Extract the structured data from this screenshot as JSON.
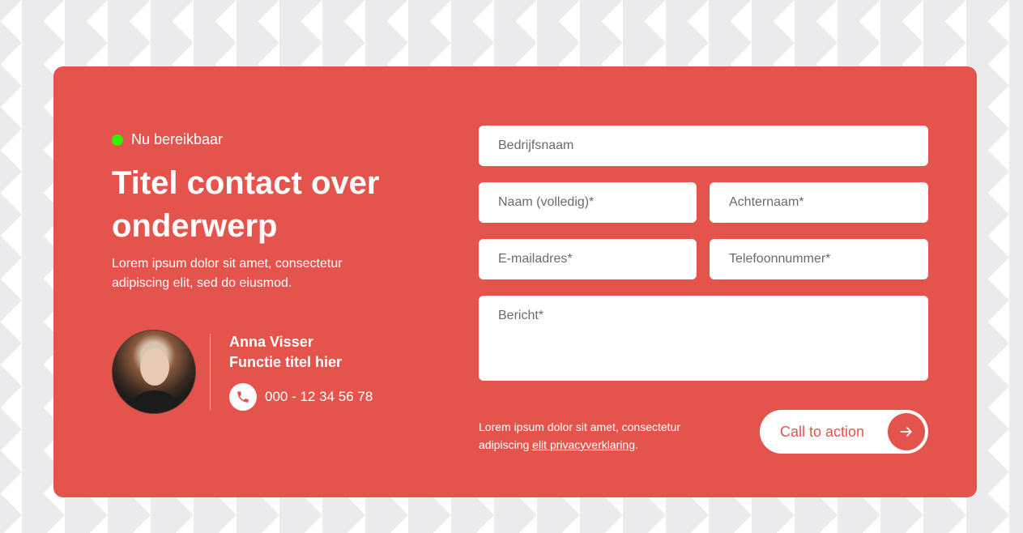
{
  "status": {
    "label": "Nu bereikbaar",
    "color": "#33f000"
  },
  "heading": {
    "title": "Titel contact over onderwerp",
    "description": "Lorem ipsum dolor sit amet, consectetur adipiscing elit, sed do eiusmod."
  },
  "contact": {
    "name": "Anna Visser",
    "role": "Functie titel hier",
    "phone": "000 - 12 34 56 78"
  },
  "form": {
    "company": "Bedrijfsnaam",
    "first_name": "Naam (volledig)*",
    "last_name": "Achternaam*",
    "email": "E-mailadres*",
    "phone": "Telefoonnummer*",
    "message": "Bericht*"
  },
  "consent": {
    "text_before": "Lorem ipsum dolor sit amet, consectetur adipiscing ",
    "link": "elit privacyverklaring",
    "text_after": "."
  },
  "cta": {
    "label": "Call to action"
  },
  "colors": {
    "accent": "#e5544c",
    "background_pattern": "#ebebed"
  }
}
